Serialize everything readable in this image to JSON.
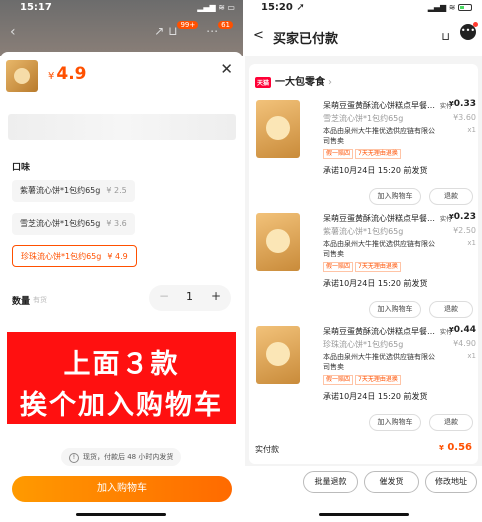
{
  "left": {
    "status_time": "15:17",
    "status_icons": "▂▄▆ ≋ ▭",
    "back_icon": "back-icon",
    "top_icons": {
      "share": "↗",
      "cart_badge": "99+",
      "more_badge": "61"
    },
    "price_currency": "¥",
    "price_value": "4.9",
    "close_symbol": "✕",
    "flavor_label": "口味",
    "options": [
      {
        "name": "紫薯流心饼*1包约65g",
        "price": "¥ 2.5",
        "selected": false
      },
      {
        "name": "雪芝流心饼*1包约65g",
        "price": "¥ 3.6",
        "selected": false
      },
      {
        "name": "珍珠流心饼*1包约65g",
        "price": "¥ 4.9",
        "selected": true
      }
    ],
    "quantity_label": "数量",
    "quantity_sub": "有货",
    "quantity_minus": "−",
    "quantity_value": "1",
    "quantity_plus": "+",
    "banner_line1": "上面３款",
    "banner_line2": "挨个加入购物车",
    "shipping_icon": "!",
    "shipping_note": "现货，付款后 48 小时内发货",
    "add_to_cart": "加入购物车",
    "accent": "#ff5000"
  },
  "right": {
    "status_time": "15:20 ➚",
    "status_icons": "▂▄▆ ≋",
    "back_symbol": "<",
    "title": "买家已付款",
    "cart_symbol": "⊔",
    "more_symbol": "•••",
    "shop_badge": "天猫",
    "shop_name": "一大包零食",
    "shop_arrow": "›",
    "items": [
      {
        "title": "呆萌豆蛋黄酥流心饼糕点早餐面包",
        "spec": "雪芝流心饼*1包约65g",
        "seller": "本品由泉州大牛推优选供应链有限公司售卖",
        "tag1": "假一赔四",
        "tag2": "7天无理由退换",
        "paid_label": "实付",
        "currency": "¥",
        "paid": "0.33",
        "orig": "¥3.60",
        "count": "x1",
        "promise": "承诺10月24日 15:20 前发货",
        "btn_add": "加入购物车",
        "btn_refund": "退款"
      },
      {
        "title": "呆萌豆蛋黄酥流心饼糕点早餐面包",
        "spec": "紫薯流心饼*1包约65g",
        "seller": "本品由泉州大牛推优选供应链有限公司售卖",
        "tag1": "假一赔四",
        "tag2": "7天无理由退换",
        "paid_label": "实付",
        "currency": "¥",
        "paid": "0.23",
        "orig": "¥2.50",
        "count": "x1",
        "promise": "承诺10月24日 15:20 前发货",
        "btn_add": "加入购物车",
        "btn_refund": "退款"
      },
      {
        "title": "呆萌豆蛋黄酥流心饼糕点早餐面包",
        "spec": "珍珠流心饼*1包约65g",
        "seller": "本品由泉州大牛推优选供应链有限公司售卖",
        "tag1": "假一赔四",
        "tag2": "7天无理由退换",
        "paid_label": "实付",
        "currency": "¥",
        "paid": "0.44",
        "orig": "¥4.90",
        "count": "x1",
        "promise": "承诺10月24日 15:20 前发货",
        "btn_add": "加入购物车",
        "btn_refund": "退款"
      }
    ],
    "total_label": "实付款",
    "total_currency": "¥",
    "total_value": "0.56",
    "bottom_buttons": [
      "批量退款",
      "催发货",
      "修改地址"
    ],
    "accent": "#ff5000"
  }
}
